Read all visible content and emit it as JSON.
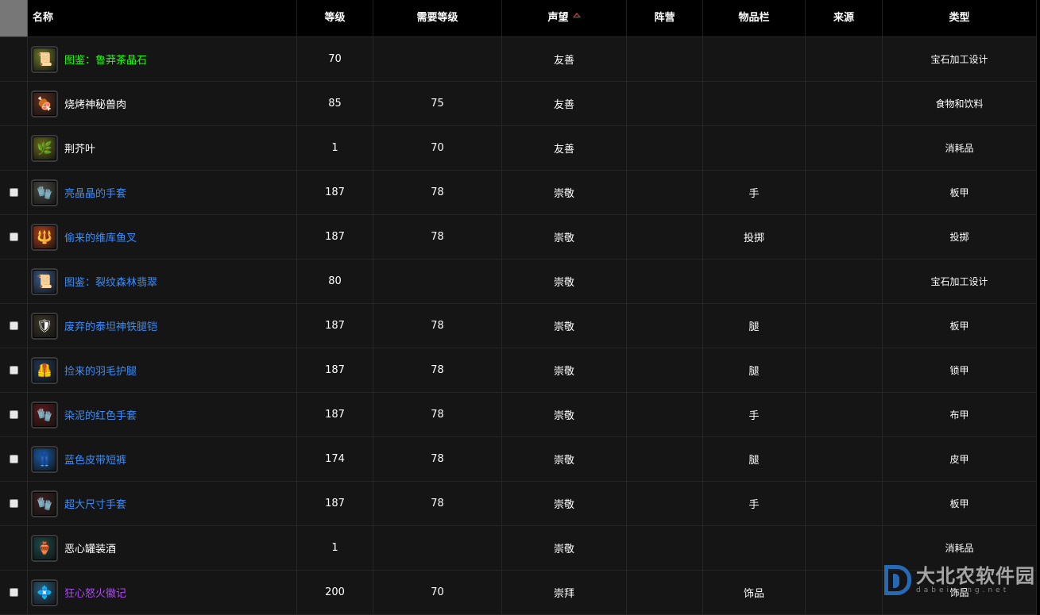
{
  "headers": [
    "",
    "名称",
    "等级",
    "需要等级",
    "声望",
    "阵营",
    "物品栏",
    "来源",
    "类型"
  ],
  "sort_column": "声望",
  "rows": [
    {
      "has_checkbox": false,
      "icon": "recipe-scroll-icon",
      "icon_bg": "#6b7a2a",
      "icon_glyph": "📜",
      "name": "图鉴：鲁莽茶晶石",
      "name_color": "#1eff00",
      "level": "70",
      "req_level": "",
      "reputation": "友善",
      "faction": "",
      "slot": "",
      "source": "",
      "type": "宝石加工设计"
    },
    {
      "has_checkbox": false,
      "icon": "roasted-meat-icon",
      "icon_bg": "#5a2d20",
      "icon_glyph": "🍖",
      "name": "烧烤神秘兽肉",
      "name_color": "#ffffff",
      "level": "85",
      "req_level": "75",
      "reputation": "友善",
      "faction": "",
      "slot": "",
      "source": "",
      "type": "食物和饮料"
    },
    {
      "has_checkbox": false,
      "icon": "herb-leaf-icon",
      "icon_bg": "#6a6a1a",
      "icon_glyph": "🌿",
      "name": "荆芥叶",
      "name_color": "#ffffff",
      "level": "1",
      "req_level": "70",
      "reputation": "友善",
      "faction": "",
      "slot": "",
      "source": "",
      "type": "消耗品"
    },
    {
      "has_checkbox": true,
      "icon": "plate-gauntlet-icon",
      "icon_bg": "#4a4a44",
      "icon_glyph": "🧤",
      "name": "亮晶晶的手套",
      "name_color": "#3c8df7",
      "level": "187",
      "req_level": "78",
      "reputation": "崇敬",
      "faction": "",
      "slot": "手",
      "source": "",
      "type": "板甲"
    },
    {
      "has_checkbox": true,
      "icon": "thrown-harpoon-icon",
      "icon_bg": "#b0401a",
      "icon_glyph": "🔱",
      "name": "偷来的维库鱼叉",
      "name_color": "#3c8df7",
      "level": "187",
      "req_level": "78",
      "reputation": "崇敬",
      "faction": "",
      "slot": "投掷",
      "source": "",
      "type": "投掷"
    },
    {
      "has_checkbox": false,
      "icon": "recipe-scroll-icon",
      "icon_bg": "#3a5a8a",
      "icon_glyph": "📜",
      "name": "图鉴：裂纹森林翡翠",
      "name_color": "#3c8df7",
      "level": "80",
      "req_level": "",
      "reputation": "崇敬",
      "faction": "",
      "slot": "",
      "source": "",
      "type": "宝石加工设计"
    },
    {
      "has_checkbox": true,
      "icon": "plate-legs-icon",
      "icon_bg": "#3a3528",
      "icon_glyph": "🛡",
      "name": "废弃的泰坦神铁腿铠",
      "name_color": "#3c8df7",
      "level": "187",
      "req_level": "78",
      "reputation": "崇敬",
      "faction": "",
      "slot": "腿",
      "source": "",
      "type": "板甲"
    },
    {
      "has_checkbox": true,
      "icon": "mail-legs-icon",
      "icon_bg": "#1e3a5a",
      "icon_glyph": "🦺",
      "name": "捡来的羽毛护腿",
      "name_color": "#3c8df7",
      "level": "187",
      "req_level": "78",
      "reputation": "崇敬",
      "faction": "",
      "slot": "腿",
      "source": "",
      "type": "锁甲"
    },
    {
      "has_checkbox": true,
      "icon": "cloth-glove-icon",
      "icon_bg": "#5a1a1a",
      "icon_glyph": "🧤",
      "name": "染泥的红色手套",
      "name_color": "#3c8df7",
      "level": "187",
      "req_level": "78",
      "reputation": "崇敬",
      "faction": "",
      "slot": "手",
      "source": "",
      "type": "布甲"
    },
    {
      "has_checkbox": true,
      "icon": "leather-shorts-icon",
      "icon_bg": "#1a5aa0",
      "icon_glyph": "👖",
      "name": "蓝色皮带短裤",
      "name_color": "#3c8df7",
      "level": "174",
      "req_level": "78",
      "reputation": "崇敬",
      "faction": "",
      "slot": "腿",
      "source": "",
      "type": "皮甲"
    },
    {
      "has_checkbox": true,
      "icon": "plate-gauntlet-icon",
      "icon_bg": "#3a2020",
      "icon_glyph": "🧤",
      "name": "超大尺寸手套",
      "name_color": "#3c8df7",
      "level": "187",
      "req_level": "78",
      "reputation": "崇敬",
      "faction": "",
      "slot": "手",
      "source": "",
      "type": "板甲"
    },
    {
      "has_checkbox": false,
      "icon": "potion-jar-icon",
      "icon_bg": "#1a4a4a",
      "icon_glyph": "🏺",
      "name": "恶心罐装酒",
      "name_color": "#ffffff",
      "level": "1",
      "req_level": "",
      "reputation": "崇敬",
      "faction": "",
      "slot": "",
      "source": "",
      "type": "消耗品"
    },
    {
      "has_checkbox": true,
      "icon": "insignia-icon",
      "icon_bg": "#2a5a7a",
      "icon_glyph": "💠",
      "name": "狂心怒火徽记",
      "name_color": "#b048f8",
      "level": "200",
      "req_level": "70",
      "reputation": "崇拜",
      "faction": "",
      "slot": "饰品",
      "source": "",
      "type": "饰品"
    }
  ],
  "watermark": {
    "cn": "大北农软件园",
    "en": "dabeinong.net"
  }
}
